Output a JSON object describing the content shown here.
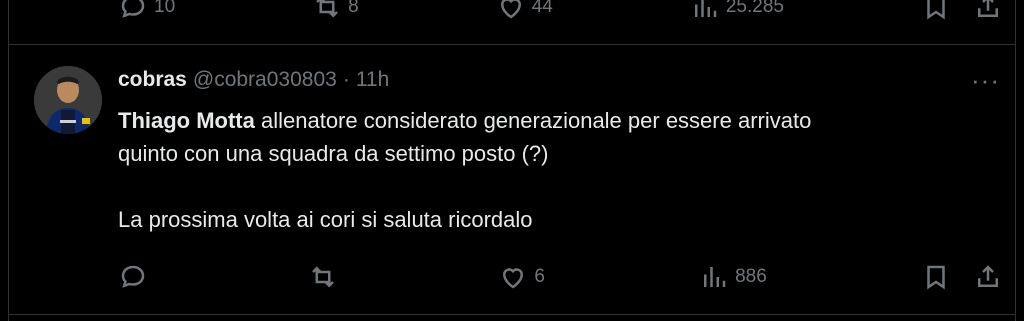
{
  "previous_post": {
    "replies": "10",
    "reposts": "8",
    "likes": "44",
    "views": "25.285"
  },
  "post": {
    "display_name": "cobras",
    "handle": "@cobra030803",
    "separator": "·",
    "time": "11h",
    "more": "···",
    "text_bold": "Thiago Motta",
    "text_line1_rest": " allenatore considerato generazionale per essere arrivato",
    "text_line2": "quinto con una squadra da settimo posto (?)",
    "text_line3": "La prossima volta ai cori si saluta ricordalo",
    "replies": "",
    "reposts": "",
    "likes": "6",
    "views": "886"
  },
  "colors": {
    "background": "#000000",
    "text": "#e7e9ea",
    "muted": "#71767b",
    "border": "#2f3336"
  }
}
